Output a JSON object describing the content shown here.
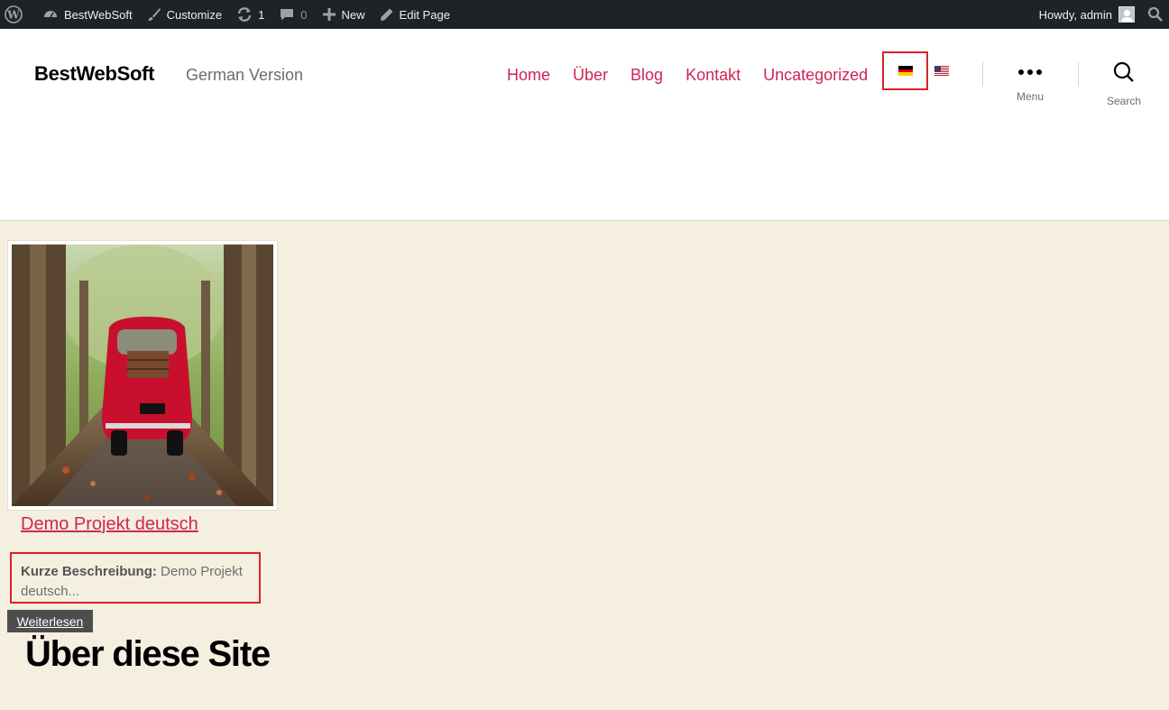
{
  "admin_bar": {
    "wp_logo_icon": "wordpress-icon",
    "site_name": "BestWebSoft",
    "customize": "Customize",
    "updates_count": "1",
    "comments_count": "0",
    "new": "New",
    "edit_page": "Edit Page",
    "howdy": "Howdy, admin"
  },
  "header": {
    "site_title": "BestWebSoft",
    "site_description": "German Version",
    "nav": [
      "Home",
      "Über",
      "Blog",
      "Kontakt",
      "Uncategorized"
    ],
    "languages": [
      {
        "code": "de",
        "active": true
      },
      {
        "code": "en-us",
        "active": false
      }
    ],
    "menu_label": "Menu",
    "search_label": "Search"
  },
  "post": {
    "title": "Demo Projekt deutsch",
    "excerpt_label": "Kurze Beschreibung:",
    "excerpt_text": "Demo Projekt deutsch...",
    "read_more": "Weiterlesen"
  },
  "widget": {
    "title": "Über diese Site"
  },
  "colors": {
    "accent": "#cd2653",
    "admin_bar_bg": "#1d2327",
    "content_bg": "#f5efe0",
    "highlight_border": "#d9222a"
  }
}
